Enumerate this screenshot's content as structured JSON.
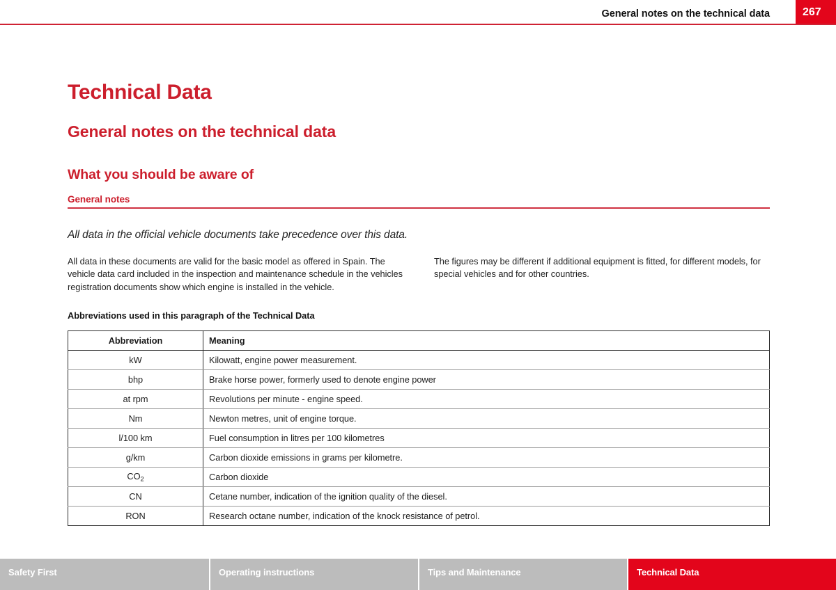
{
  "header": {
    "title": "General notes on the technical data",
    "page_number": "267",
    "accent_color": "#e3051b"
  },
  "titles": {
    "main": "Technical Data",
    "section": "General notes on the technical data",
    "subsection": "What you should be aware of"
  },
  "subhead": {
    "label": "General notes"
  },
  "intro": {
    "italic_note": "All data in the official vehicle documents take precedence over this data."
  },
  "body": {
    "left_column": "All data in these documents are valid for the basic model as offered in Spain. The vehicle data card included in the inspection and maintenance schedule in the vehicles registration documents show which engine is installed in the vehicle.",
    "right_column": "The figures may be different if additional equipment is fitted, for different models, for special vehicles and for other countries."
  },
  "table": {
    "caption": "Abbreviations used in this paragraph of the Technical Data",
    "headers": {
      "abbreviation": "Abbreviation",
      "meaning": "Meaning"
    },
    "rows": [
      {
        "abbreviation": "kW",
        "meaning": "Kilowatt, engine power measurement."
      },
      {
        "abbreviation": "bhp",
        "meaning": "Brake horse power, formerly used to denote engine power"
      },
      {
        "abbreviation": "at rpm",
        "meaning": "Revolutions per minute - engine speed."
      },
      {
        "abbreviation": "Nm",
        "meaning": "Newton metres, unit of engine torque."
      },
      {
        "abbreviation": "l/100 km",
        "meaning": "Fuel consumption in litres per 100 kilometres"
      },
      {
        "abbreviation": "g/km",
        "meaning": "Carbon dioxide emissions in grams per kilometre."
      },
      {
        "abbreviation": "CO2",
        "abbreviation_base": "CO",
        "abbreviation_sub": "2",
        "meaning": "Carbon dioxide"
      },
      {
        "abbreviation": "CN",
        "meaning": "Cetane number, indication of the ignition quality of the diesel."
      },
      {
        "abbreviation": "RON",
        "meaning": "Research octane number, indication of the knock resistance of petrol."
      }
    ]
  },
  "footer": {
    "tabs": [
      {
        "label": "Safety First",
        "active": false
      },
      {
        "label": "Operating instructions",
        "active": false
      },
      {
        "label": "Tips and Maintenance",
        "active": false
      },
      {
        "label": "Technical Data",
        "active": true
      }
    ]
  }
}
